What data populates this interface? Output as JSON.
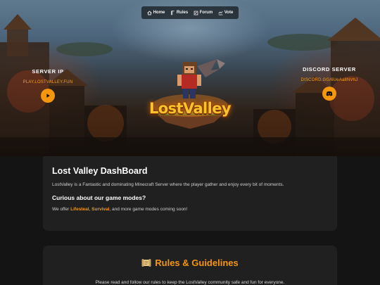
{
  "nav": {
    "items": [
      {
        "label": "Home",
        "icon": "home-icon"
      },
      {
        "label": "Rules",
        "icon": "rules-icon"
      },
      {
        "label": "Forum",
        "icon": "forum-icon"
      },
      {
        "label": "Vote",
        "icon": "vote-icon"
      }
    ]
  },
  "hero": {
    "server_ip": {
      "title": "SERVER IP",
      "address": "PLAY.LOSTVALLEY.FUN",
      "button_icon": "play-icon"
    },
    "discord": {
      "title": "DISCORD SERVER",
      "link": "DISCORD.GG/6UeAa8NVhJ",
      "button_icon": "discord-icon"
    },
    "logo_text": "LostValley"
  },
  "dashboard": {
    "title": "Lost Valley DashBoard",
    "description": "LostValley is a Fantastic and dominating Minecraft Server where the player gather and enjoy every bit of moments.",
    "subtitle": "Curious about our game modes?",
    "modes_prefix": "We offer ",
    "mode_1": "Lifesteal",
    "separator": ", ",
    "mode_2": "Survival",
    "modes_suffix": ", and more game modes coming soon!"
  },
  "rules": {
    "icon": "scroll-icon",
    "title": "Rules & Guidelines",
    "description": "Please read and follow our rules to keep the LostValley community safe and fun for everyone."
  },
  "colors": {
    "accent": "#f5970e",
    "background": "#141414",
    "card": "#202020"
  }
}
